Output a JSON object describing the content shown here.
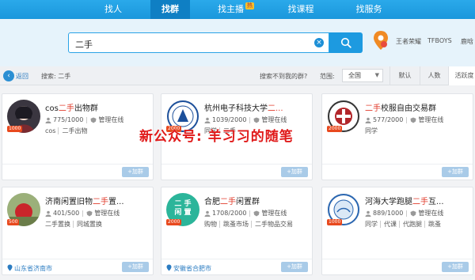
{
  "nav": {
    "items": [
      {
        "label": "找人"
      },
      {
        "label": "找群"
      },
      {
        "label": "找主播",
        "badge": "热"
      },
      {
        "label": "找课程"
      },
      {
        "label": "找服务"
      }
    ],
    "active_index": 1,
    "bg_color": "#1a97dc"
  },
  "search": {
    "value": "二手",
    "clear_icon": "clear-icon",
    "button_icon": "search-icon"
  },
  "header_right": {
    "pin_icon": "location-pin-icon",
    "labels": [
      "王者荣耀",
      "TFBOYS",
      "鹿晗"
    ]
  },
  "filter_bar": {
    "back_label": "返回",
    "search_label": "搜索: 二手",
    "not_found_text": "搜索不到我的群?",
    "range_label": "范围:",
    "range_value": "全国",
    "sort_tabs": [
      "默认",
      "人数",
      "活跃度"
    ],
    "active_sort": 2
  },
  "cards": [
    {
      "name_prefix": "cos",
      "name_hl": "二手",
      "name_suffix": "出物群",
      "members": "775/1000",
      "admin": "管理在线",
      "tags": [
        "cos",
        "二手出物"
      ],
      "level": "1000",
      "join": "+加群",
      "location": ""
    },
    {
      "name_prefix": "杭州电子科技大学",
      "name_hl": "二...",
      "name_suffix": "",
      "members": "1039/2000",
      "admin": "管理在线",
      "tags": [
        "同学",
        "二手"
      ],
      "level": "2000",
      "join": "+加群",
      "location": ""
    },
    {
      "name_prefix": "",
      "name_hl": "二手",
      "name_suffix": "校服自由交易群",
      "members": "577/2000",
      "admin": "管理在线",
      "tags": [
        "同学"
      ],
      "level": "2000",
      "join": "+加群",
      "location": ""
    },
    {
      "name_prefix": "济南闲置旧物",
      "name_hl": "二手",
      "name_suffix": "置...",
      "members": "401/500",
      "admin": "管理在线",
      "tags": [
        "二手置换",
        "同城置换"
      ],
      "level": "500",
      "join": "+加群",
      "location": "山东省济南市"
    },
    {
      "name_prefix": "合肥",
      "name_hl": "二手",
      "name_suffix": "闲置群",
      "members": "1708/2000",
      "admin": "管理在线",
      "tags": [
        "购物",
        "跳蚤市场",
        "二手物品交易"
      ],
      "level": "2000",
      "join": "+加群",
      "location": "安徽省合肥市",
      "avatar_text": [
        "二 手",
        "闲 置"
      ]
    },
    {
      "name_prefix": "河海大学跑腿",
      "name_hl": "二手",
      "name_suffix": "互...",
      "members": "889/1000",
      "admin": "管理在线",
      "tags": [
        "同学",
        "代课",
        "代跑腿",
        "跳蚤"
      ],
      "level": "1000",
      "join": "+加群",
      "location": ""
    }
  ],
  "watermark": "新公众号: 羊习习的随笔"
}
